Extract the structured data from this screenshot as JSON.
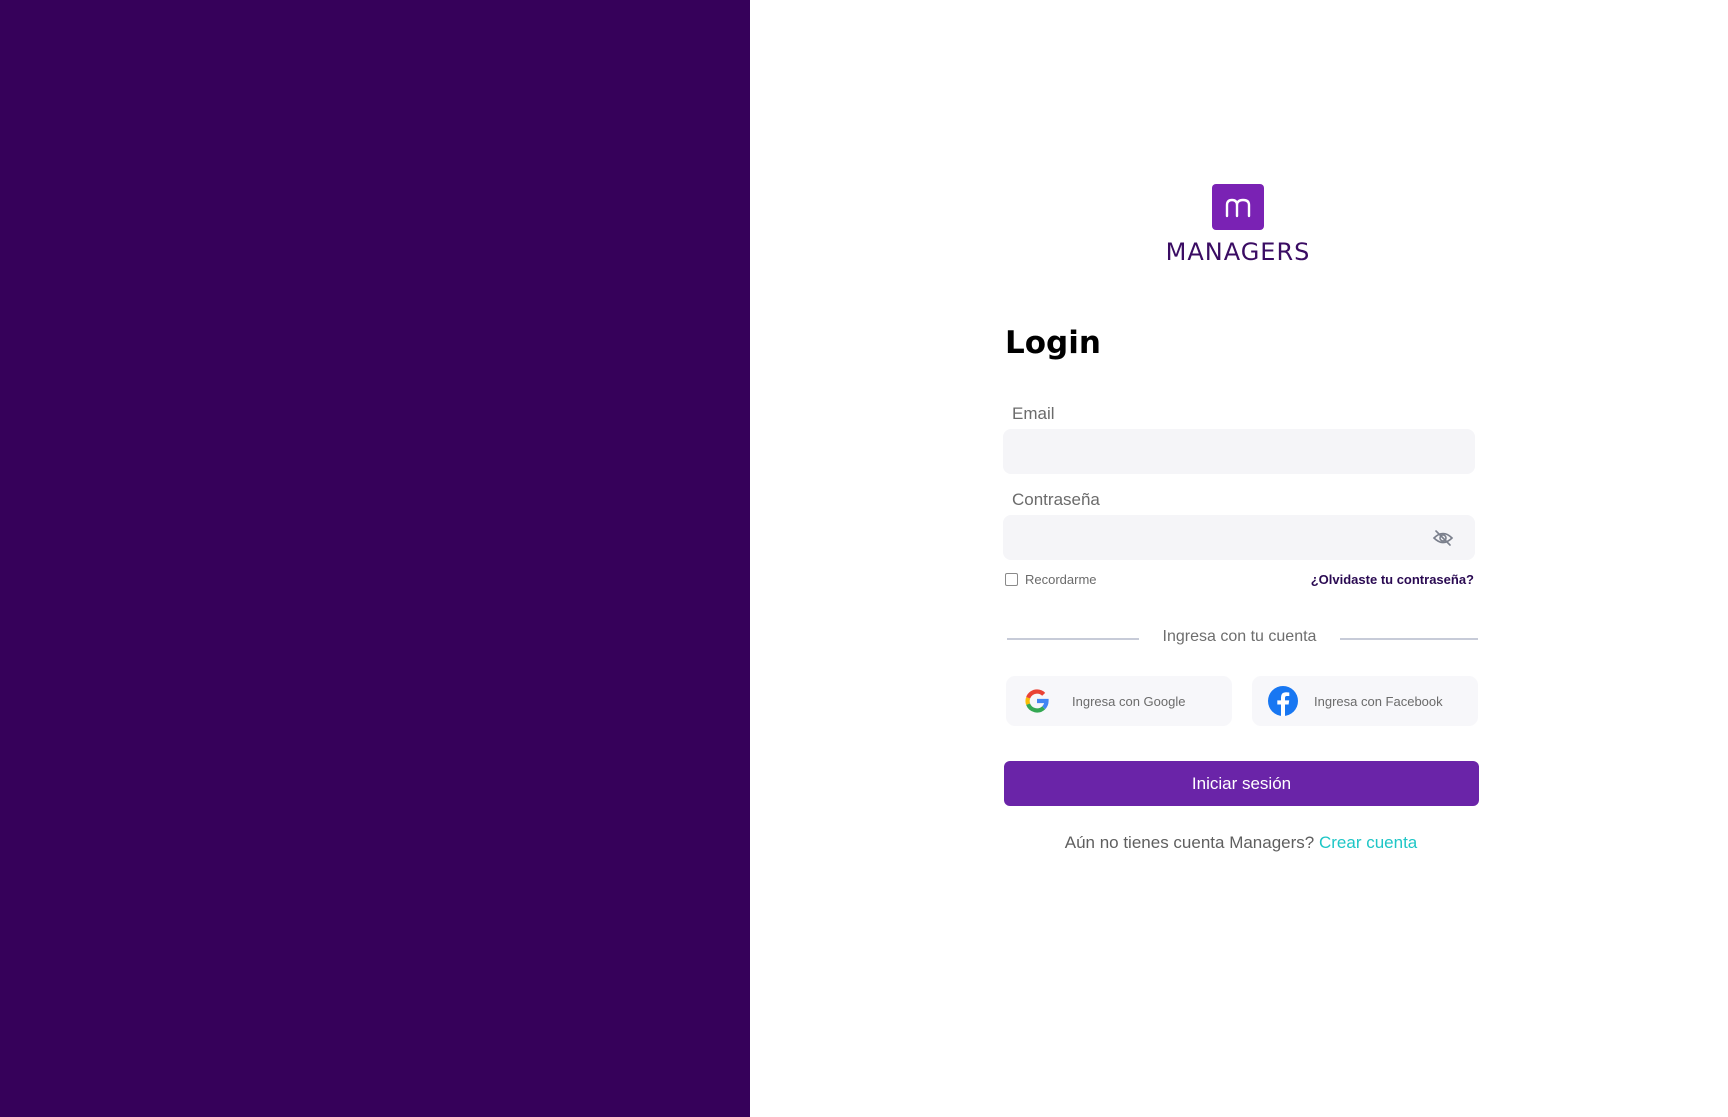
{
  "brand": {
    "name": "MANAGERS",
    "accent_color": "#7a22b4",
    "panel_color": "#36015a"
  },
  "login": {
    "title": "Login",
    "email_label": "Email",
    "email_value": "",
    "password_label": "Contraseña",
    "password_value": "",
    "remember_label": "Recordarme",
    "remember_checked": false,
    "forgot_label": "¿Olvidaste tu contraseña?",
    "divider_text": "Ingresa con tu cuenta",
    "google_label": "Ingresa con Google",
    "facebook_label": "Ingresa con Facebook",
    "submit_label": "Iniciar sesión",
    "signup_prompt": "Aún no tienes cuenta Managers?",
    "signup_link": "Crear cuenta"
  },
  "icons": {
    "logo": "managers-m-logo-icon",
    "password_toggle": "eye-off-icon",
    "google": "google-icon",
    "facebook": "facebook-icon"
  }
}
